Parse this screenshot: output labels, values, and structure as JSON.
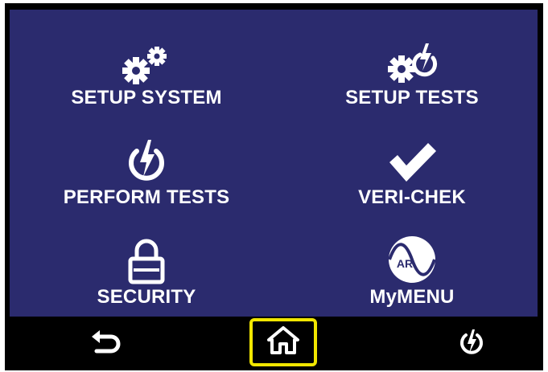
{
  "menu": {
    "items": [
      {
        "label": "SETUP SYSTEM",
        "icon": "gears-icon"
      },
      {
        "label": "SETUP TESTS",
        "icon": "gear-power-icon"
      },
      {
        "label": "PERFORM TESTS",
        "icon": "power-bolt-icon"
      },
      {
        "label": "VERI-CHEK",
        "icon": "checkmark-icon"
      },
      {
        "label": "SECURITY",
        "icon": "padlock-icon"
      },
      {
        "label": "MyMENU",
        "icon": "ar-logo-icon"
      }
    ]
  },
  "mymenu_logo_text": "AR",
  "nav": {
    "back": "back-arrow-icon",
    "home": "home-icon",
    "perform": "power-bolt-icon"
  },
  "colors": {
    "screen_bg": "#2b2b6e",
    "bar_bg": "#000000",
    "highlight": "#f1e600",
    "text": "#ffffff"
  }
}
